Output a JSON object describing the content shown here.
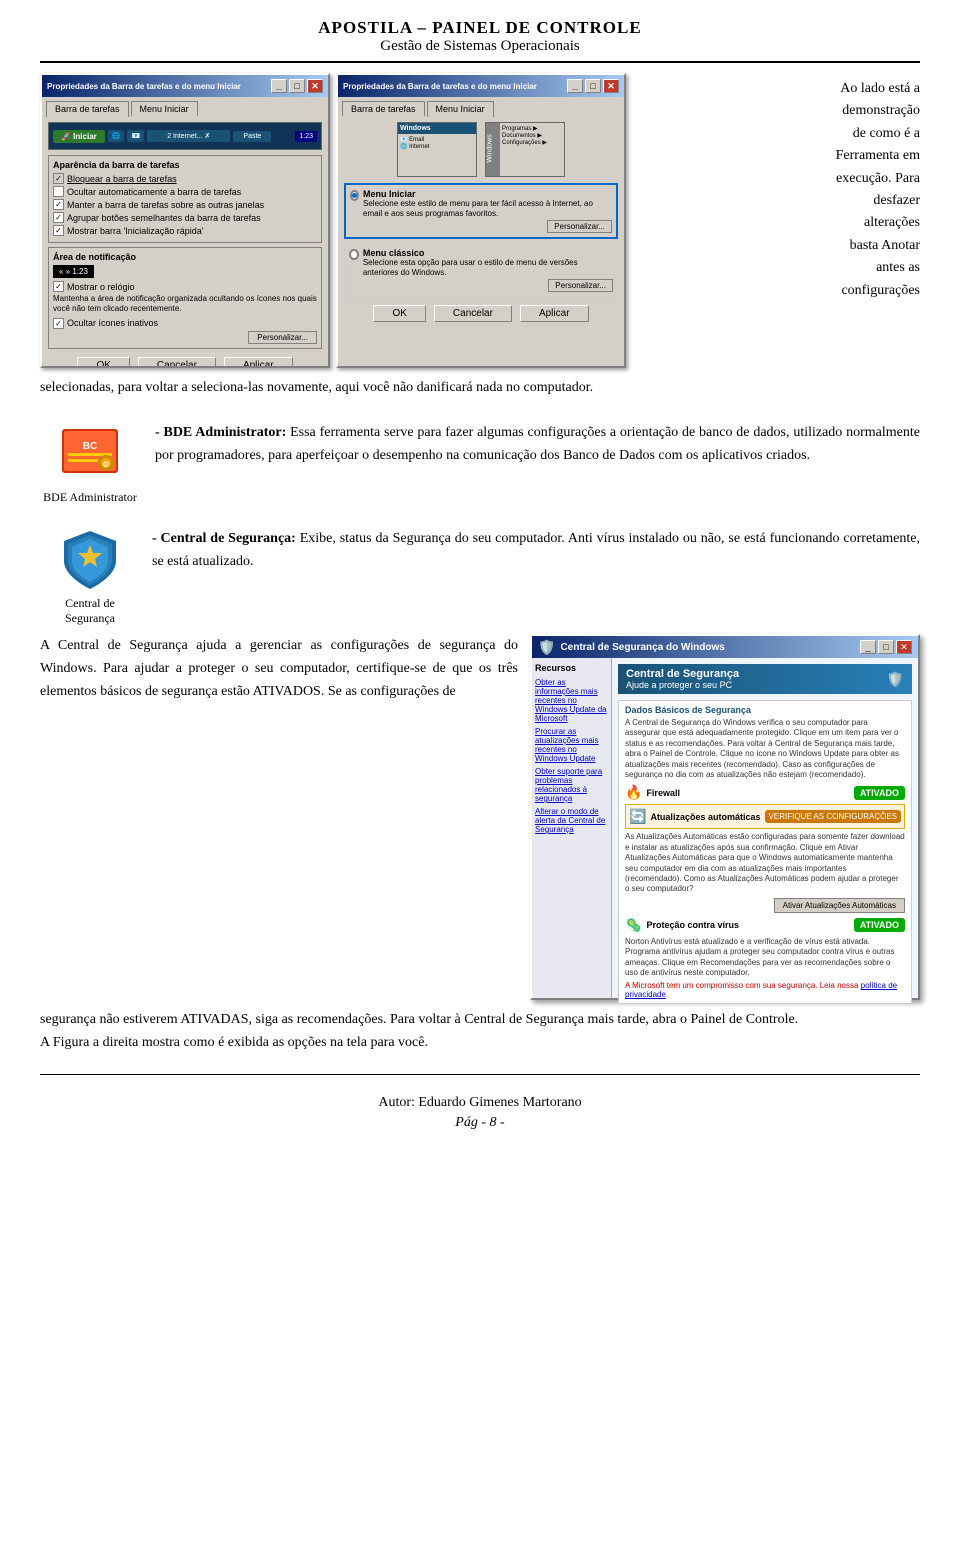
{
  "header": {
    "title": "APOSTILA – PAINEL DE CONTROLE",
    "subtitle": "Gestão de Sistemas Operacionais"
  },
  "dialog1": {
    "title": "Propriedades da Barra de tarefas e do menu Iniciar",
    "tabs": [
      "Barra de tarefas",
      "Menu Iniciar"
    ],
    "active_tab": "Barra de tarefas",
    "section1_title": "Aparência da barra de tarefas",
    "checkboxes": [
      {
        "label": "Bloquear a barra de tarefas",
        "checked": true
      },
      {
        "label": "Ocultar automaticamente a barra de tarefas",
        "checked": false
      },
      {
        "label": "Manter a barra de tarefas sobre as outras janelas",
        "checked": true
      },
      {
        "label": "Agrupar botões semelhantes da barra de tarefas",
        "checked": true
      },
      {
        "label": "Mostrar barra 'Inicialização rápida'",
        "checked": true
      }
    ],
    "section2_title": "Área de notificação",
    "clock_text": "1:23",
    "clock_checkbox": "Mostrar o relógio",
    "notif_text": "Mantenha a área de notificação organizada ocultando os ícones nos quais você não tem clicado recentemente.",
    "notif_checkbox": "Ocultar ícones inativos",
    "buttons": [
      "OK",
      "Cancelar",
      "Aplicar"
    ]
  },
  "dialog2": {
    "title": "Propriedades da Barra de tarefas e do menu Iniciar",
    "tabs": [
      "Barra de tarefas",
      "Menu Iniciar"
    ],
    "active_tab": "Menu Iniciar",
    "option1_label": "Menu Iniciar",
    "option1_desc": "Selecione este estilo de menu para ter fácil acesso à Internet, ao email e aos seus programas favoritos.",
    "option2_label": "Menu Clássico",
    "option2_desc": "Selecione esta opção para usar o estilo de menu de versões anteriores do Windows.",
    "btn_personalize1": "Personalizar...",
    "btn_personalize2": "Personalizar...",
    "buttons": [
      "OK",
      "Cancelar",
      "Aplicar"
    ]
  },
  "right_text": {
    "line1": "Ao lado está a",
    "line2": "demonstração",
    "line3": "de como é a",
    "line4": "Ferramenta em",
    "line5": "execução. Para",
    "line6": "desfazer",
    "line7": "alterações",
    "line8": "basta  Anotar",
    "line9": "antes  as",
    "line10": "configurações"
  },
  "full_paragraph": "selecionadas, para voltar a seleciona-las novamente, aqui você não danificará nada no computador.",
  "bde_section": {
    "icon_label": "BDE Administrator",
    "heading": "- BDE Administrator:",
    "text": " Essa ferramenta serve para fazer algumas configurações a orientação de banco de dados, utilizado normalmente por programadores, para aperfeiçoar o desempenho na comunicação dos Banco de Dados com os aplicativos criados."
  },
  "central_section": {
    "icon_label": "Central de\nSegurança",
    "heading": "- Central de Segurança:",
    "intro_text": " Exibe, status da Segurança do seu computador. Anti vírus instalado ou não, se está funcionando corretamente, se está atualizado.",
    "body_text": "A Central de Segurança ajuda a gerenciar as configurações de segurança do Windows. Para ajudar a proteger o seu computador, certifique-se de que os três elementos básicos de segurança estão ATIVADOS. Se as configurações de",
    "win_title": "Central de Segurança do Windows",
    "win_header1": "Central de Segurança",
    "win_header2": "Ajude a proteger o seu PC",
    "sidebar_links": [
      "Obter as informações mais recentes no Windows Update da Microsoft",
      "Procurar as atualizações mais recentes no Windows Update",
      "Obter suporte para problemas relacionados à segurança",
      "Alterar o modo de alerta da Central de Segurança"
    ],
    "section_firewall": "Firewall",
    "firewall_status": "ATIVADO",
    "section_updates": "Atualizações automáticas",
    "updates_status": "VERIFIQUE AS CONFIGURAÇÕES",
    "section_virus": "Proteção contra vírus",
    "virus_status": "ATIVADO",
    "resources_label": "Recursos"
  },
  "bottom_texts": {
    "line1": "segurança não estiverem ATIVADAS, siga as recomendações. Para voltar à",
    "line2": "Central de Segurança mais tarde, abra o Painel de Controle.",
    "line3": "A Figura a direita mostra como é exibida as opções na tela para você."
  },
  "footer": {
    "author": "Autor: Eduardo Gimenes Martorano",
    "page": "Pág - 8 -"
  }
}
